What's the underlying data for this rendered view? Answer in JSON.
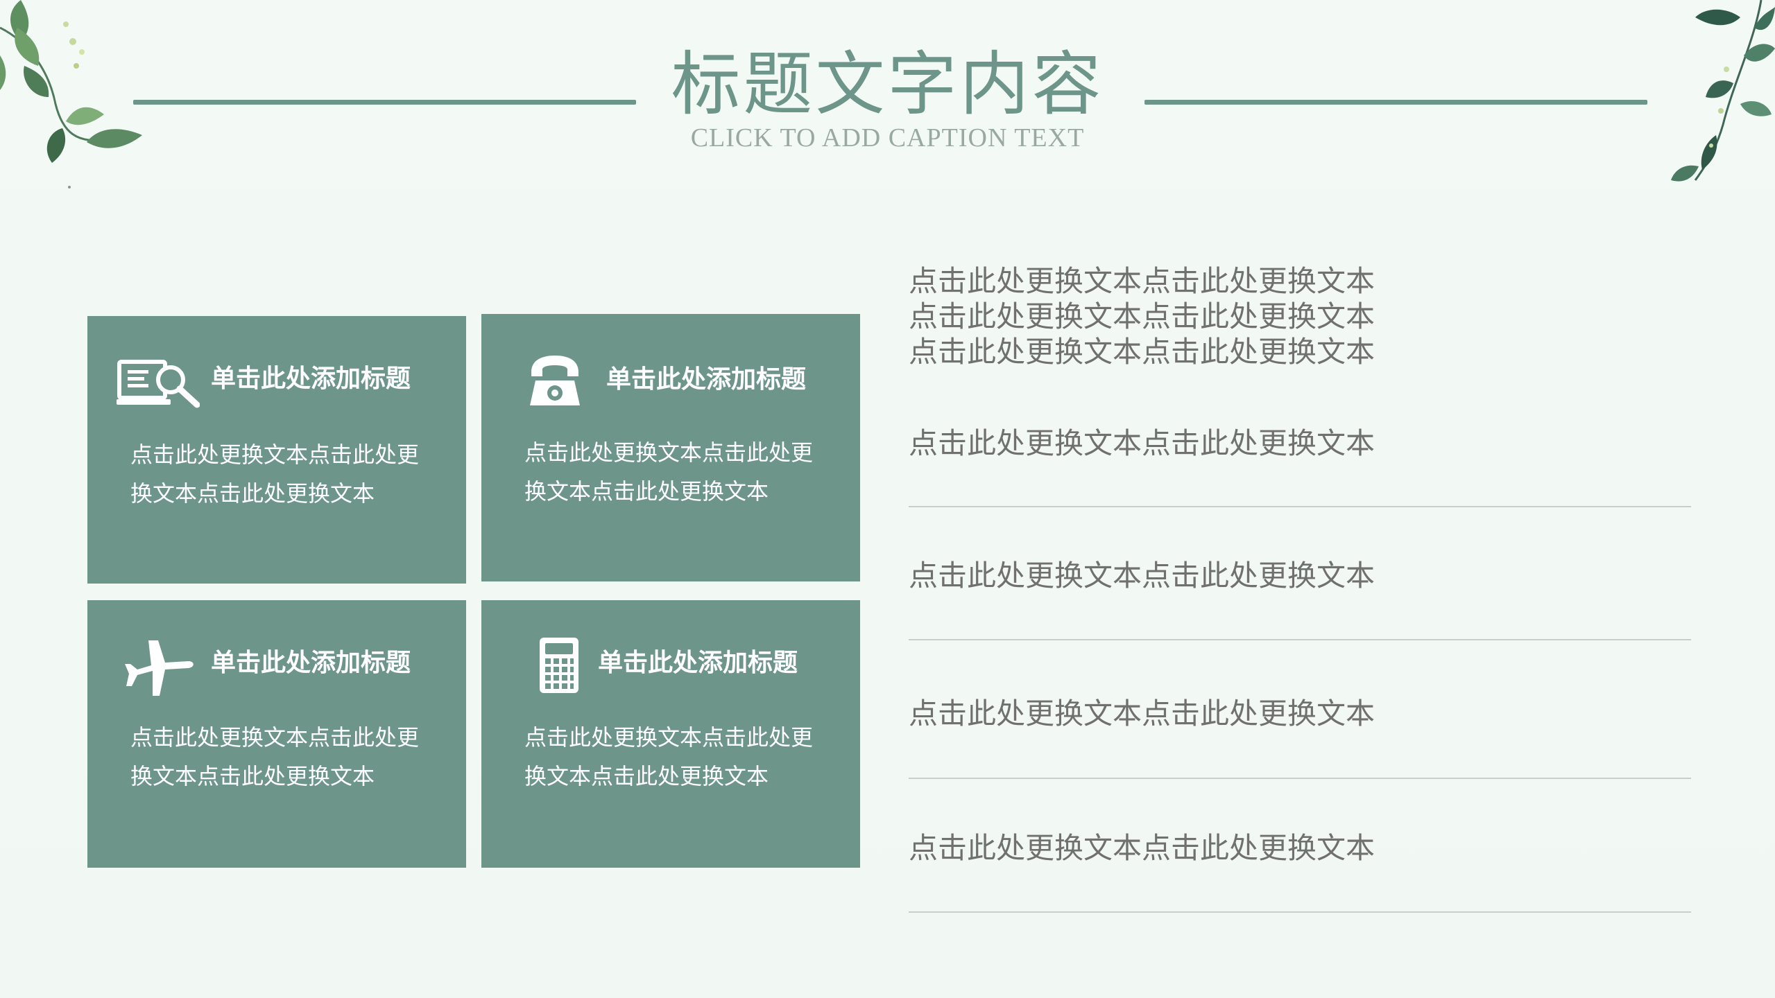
{
  "header": {
    "title": "标题文字内容",
    "caption": "CLICK TO ADD CAPTION TEXT"
  },
  "cards": [
    {
      "icon": "computer-search-icon",
      "title": "单击此处添加标题",
      "text": "点击此处更换文本点击此处更换文本点击此处更换文本"
    },
    {
      "icon": "telephone-icon",
      "title": "单击此处添加标题",
      "text": "点击此处更换文本点击此处更换文本点击此处更换文本"
    },
    {
      "icon": "airplane-icon",
      "title": "单击此处添加标题",
      "text": "点击此处更换文本点击此处更换文本点击此处更换文本"
    },
    {
      "icon": "calculator-icon",
      "title": "单击此处添加标题",
      "text": "点击此处更换文本点击此处更换文本点击此处更换文本"
    }
  ],
  "right": {
    "intro_lines": [
      "点击此处更换文本点击此处更换文本",
      "点击此处更换文本点击此处更换文本",
      "点击此处更换文本点击此处更换文本"
    ],
    "items": [
      "点击此处更换文本点击此处更换文本",
      "点击此处更换文本点击此处更换文本",
      "点击此处更换文本点击此处更换文本",
      "点击此处更换文本点击此处更换文本"
    ]
  },
  "colors": {
    "accent": "#6d958a",
    "background": "#f2f8f4",
    "body_text": "#707070",
    "caption": "#9aa8a3"
  }
}
